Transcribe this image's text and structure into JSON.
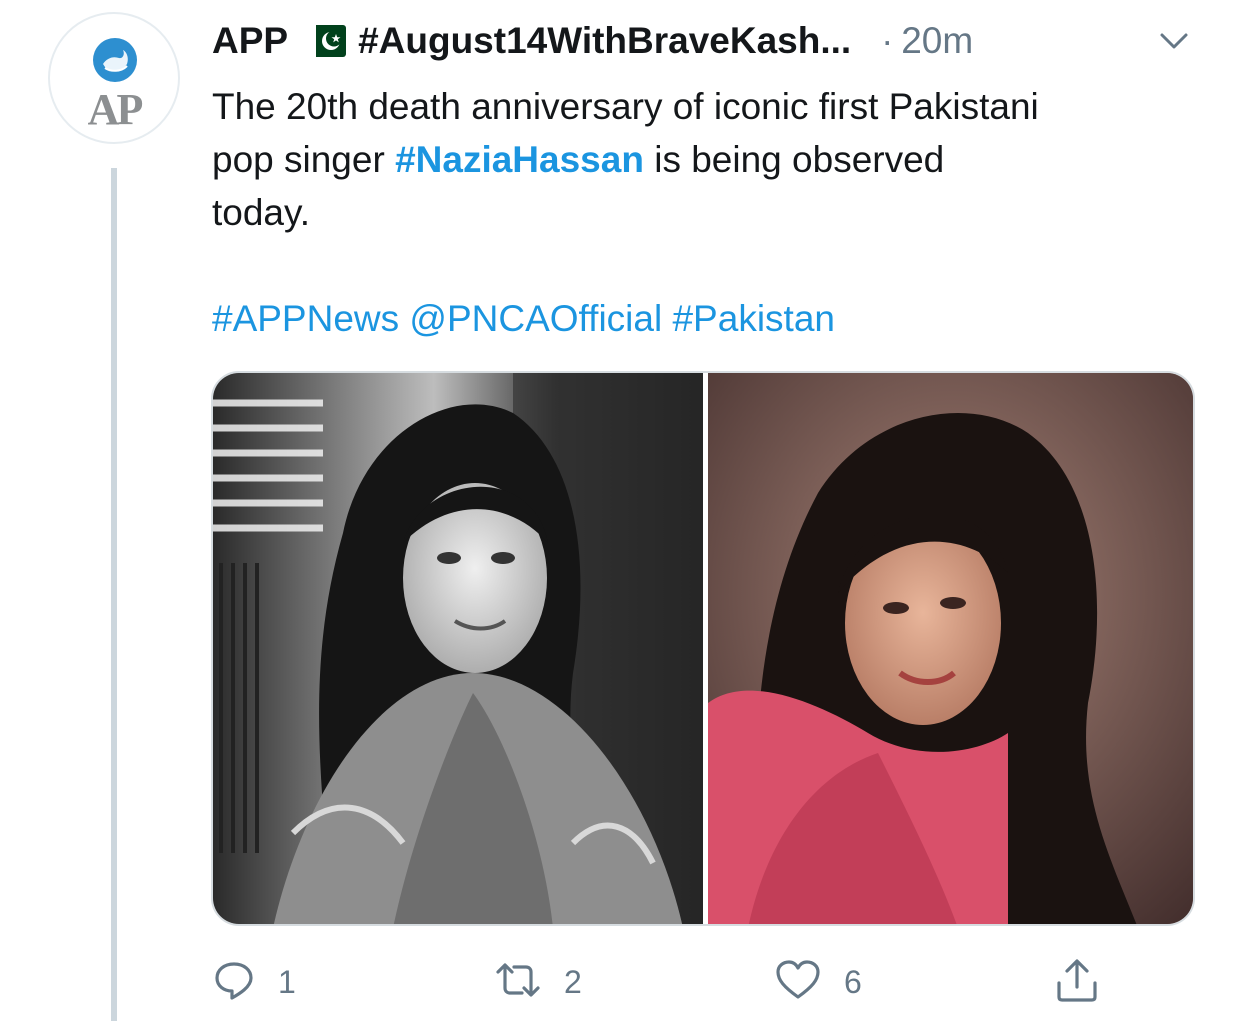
{
  "tweet": {
    "author_name": "APP",
    "author_logo_text": "AP",
    "handle": "#August14WithBraveKash...",
    "separator": "·",
    "timestamp": "20m",
    "text_line1": "The 20th death anniversary of iconic first Pakistani",
    "text_line2_before": "pop singer ",
    "text_line2_hashtag": "#NaziaHassan",
    "text_line2_after": " is being observed",
    "text_line3": "today.",
    "tag1": "#APPNews",
    "tag2": "@PNCAOfficial",
    "tag3": "#Pakistan"
  },
  "media": {
    "left_photo": "black-and-white-portrait",
    "right_photo": "color-portrait-pink-dress"
  },
  "actions": {
    "reply_count": "1",
    "retweet_count": "2",
    "like_count": "6"
  },
  "icons": {
    "flag": "pakistan-flag-icon",
    "menu": "chevron-down-icon",
    "reply": "reply-icon",
    "retweet": "retweet-icon",
    "like": "heart-icon",
    "share": "share-icon"
  },
  "colors": {
    "link": "#1b95e0",
    "secondary_text": "#657786",
    "primary_text": "#14171a",
    "thread_line": "#ccd6dd",
    "flag_green": "#01411c"
  }
}
